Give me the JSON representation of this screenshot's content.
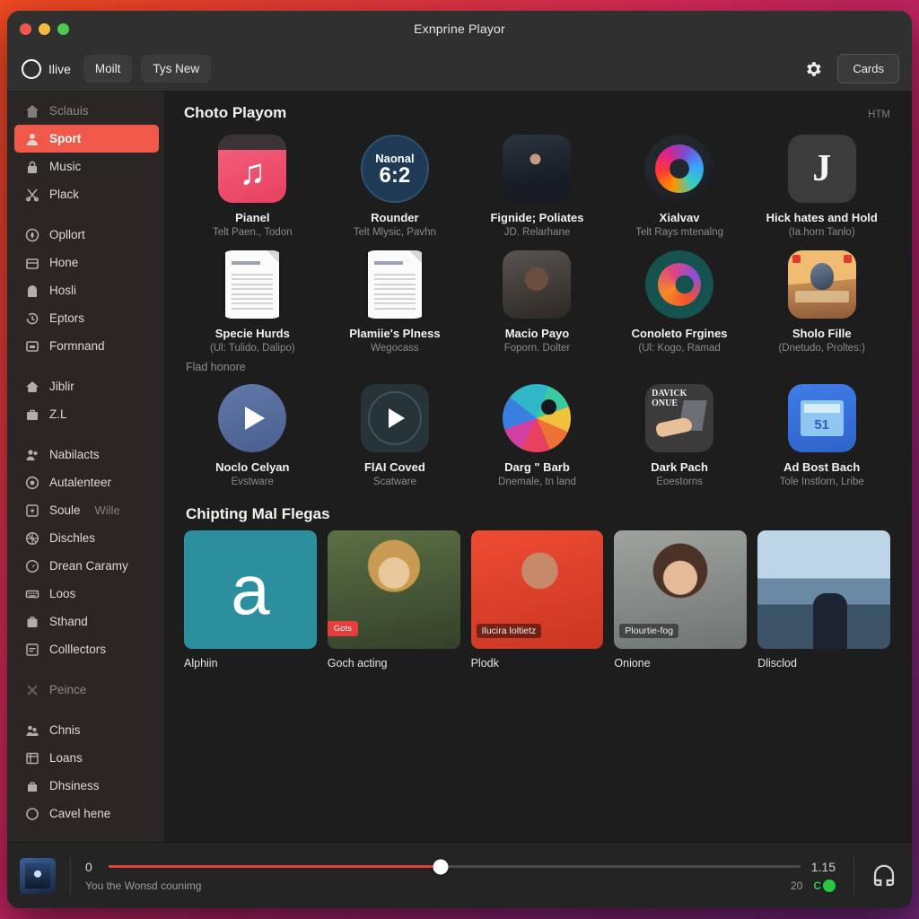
{
  "window": {
    "title": "Exnprine Playor",
    "traffic_lights": [
      "close",
      "minimize",
      "zoom"
    ]
  },
  "toolbar": {
    "brand_label": "Ilive",
    "brand_icon": "circle-ring-icon",
    "buttons": [
      {
        "label": "Moilt",
        "name": "moilt-button"
      },
      {
        "label": "Tys New",
        "name": "tys-new-button"
      }
    ],
    "gear_icon": "gear-icon",
    "cards_label": "Cards"
  },
  "sidebar": {
    "groups": [
      {
        "items": [
          {
            "label": "Sclauis",
            "icon": "home-icon",
            "muted": true,
            "active": false
          },
          {
            "label": "Sport",
            "icon": "person-icon",
            "muted": false,
            "active": true
          },
          {
            "label": "Music",
            "icon": "lock-icon",
            "muted": false,
            "active": false
          },
          {
            "label": "Plack",
            "icon": "scissors-icon",
            "muted": false,
            "active": false
          }
        ]
      },
      {
        "items": [
          {
            "label": "Opllort",
            "icon": "compass-icon",
            "muted": false,
            "active": false
          },
          {
            "label": "Hone",
            "icon": "box-icon",
            "muted": false,
            "active": false
          },
          {
            "label": "Hosli",
            "icon": "bag-icon",
            "muted": false,
            "active": false
          },
          {
            "label": "Eptors",
            "icon": "history-icon",
            "muted": false,
            "active": false
          },
          {
            "label": "Formnand",
            "icon": "screen-icon",
            "muted": false,
            "active": false
          }
        ]
      },
      {
        "items": [
          {
            "label": "Jiblir",
            "icon": "house-icon",
            "muted": false,
            "active": false
          },
          {
            "label": "Z.L",
            "icon": "briefcase-icon",
            "muted": false,
            "active": false
          }
        ]
      },
      {
        "items": [
          {
            "label": "Nabilacts",
            "icon": "people-icon",
            "muted": false,
            "active": false
          },
          {
            "label": "Autalenteer",
            "icon": "disc-icon",
            "muted": false,
            "active": false
          },
          {
            "label": "Soule",
            "sub": "Wille",
            "icon": "flash-icon",
            "muted": false,
            "active": false
          },
          {
            "label": "Dischles",
            "icon": "globe-icon",
            "muted": false,
            "active": false
          },
          {
            "label": "Drean Caramy",
            "icon": "speed-icon",
            "muted": false,
            "active": false
          },
          {
            "label": "Loos",
            "icon": "keyboard-icon",
            "muted": false,
            "active": false
          },
          {
            "label": "Sthand",
            "icon": "case-icon",
            "muted": false,
            "active": false
          },
          {
            "label": "Colllectors",
            "icon": "note-icon",
            "muted": false,
            "active": false
          }
        ]
      },
      {
        "items": [
          {
            "label": "Peince",
            "icon": "close-x-icon",
            "muted": true,
            "active": false
          }
        ]
      },
      {
        "items": [
          {
            "label": "Chnis",
            "icon": "group-icon",
            "muted": false,
            "active": false
          },
          {
            "label": "Loans",
            "icon": "window-icon",
            "muted": false,
            "active": false
          },
          {
            "label": "Dhsiness",
            "icon": "bag2-icon",
            "muted": false,
            "active": false
          },
          {
            "label": "Cavel hene",
            "icon": "circle-icon",
            "muted": false,
            "active": false
          }
        ]
      }
    ]
  },
  "main": {
    "section_title": "Choto Playom",
    "section_meta": "HTM",
    "subsection_title": "Flad honore",
    "photos_title": "Chipting Mal Flegas",
    "row1": [
      {
        "title": "Pianel",
        "sub": "Telt Paen., Todon",
        "art": "art-music"
      },
      {
        "title": "Rounder",
        "sub": "Telt Mlysic, Pavhn",
        "art": "art-clock",
        "clock_top": "Naonal",
        "clock_time": "6:2"
      },
      {
        "title": "Fignide; Poliates",
        "sub": "JD. Relarhane",
        "art": "photo-fight"
      },
      {
        "title": "Xialvav",
        "sub": "Telt Rays mtenalng",
        "art": "art-fox"
      },
      {
        "title": "Hick hates and Hold",
        "sub": "(Ia.horn Tanlo)",
        "art": "art-letter",
        "letter": "J"
      }
    ],
    "row2": [
      {
        "title": "Specie Hurds",
        "sub": "(Ul: Tulido, Dalipo)",
        "art": "art-doc"
      },
      {
        "title": "Plamiie's Plness",
        "sub": "Wegocass",
        "art": "art-doc"
      },
      {
        "title": "Macio Payo",
        "sub": "Foporn. Dolter",
        "art": "photo-glasses"
      },
      {
        "title": "Conoleto Frgines",
        "sub": "(Ul: Kogo, Ramad",
        "art": "art-teal"
      },
      {
        "title": "Sholo Fille",
        "sub": "(Dnetudo, Proltes:)",
        "art": "art-balloon"
      }
    ],
    "row3": [
      {
        "title": "Noclo Celyan",
        "sub": "Evstware",
        "art": "play-circle"
      },
      {
        "title": "FlAI Coved",
        "sub": "Scatware",
        "art": "play-square"
      },
      {
        "title": "Darg \" Barb",
        "sub": "Dnemale, tn land",
        "art": "art-swirl"
      },
      {
        "title": "Dark Pach",
        "sub": "Eoestorns",
        "art": "art-dark",
        "tag": "DAVICK ONUE"
      },
      {
        "title": "Ad Bost Bach",
        "sub": "Tole Instlorn, Lribe",
        "art": "art-blue"
      }
    ],
    "photos": [
      {
        "label": "Alphiin",
        "art": "pa-a",
        "glyph": "a"
      },
      {
        "label": "Goch acting",
        "art": "pa-blonde",
        "badge": "Gots"
      },
      {
        "label": "Plodk",
        "art": "pa-red",
        "caption": "Ilucira loltietz"
      },
      {
        "label": "Onione",
        "art": "pa-smile",
        "caption": "Plourtie-fog"
      },
      {
        "label": "Dlisclod",
        "art": "pa-mount"
      }
    ]
  },
  "player": {
    "current_time": "0",
    "total_time": "1.15",
    "track_title": "You the Wonsd counimg",
    "count": "20",
    "chip_label": "C",
    "progress_percent": 48,
    "right_icon": "cast-icon",
    "accent_color": "#e0432f"
  }
}
